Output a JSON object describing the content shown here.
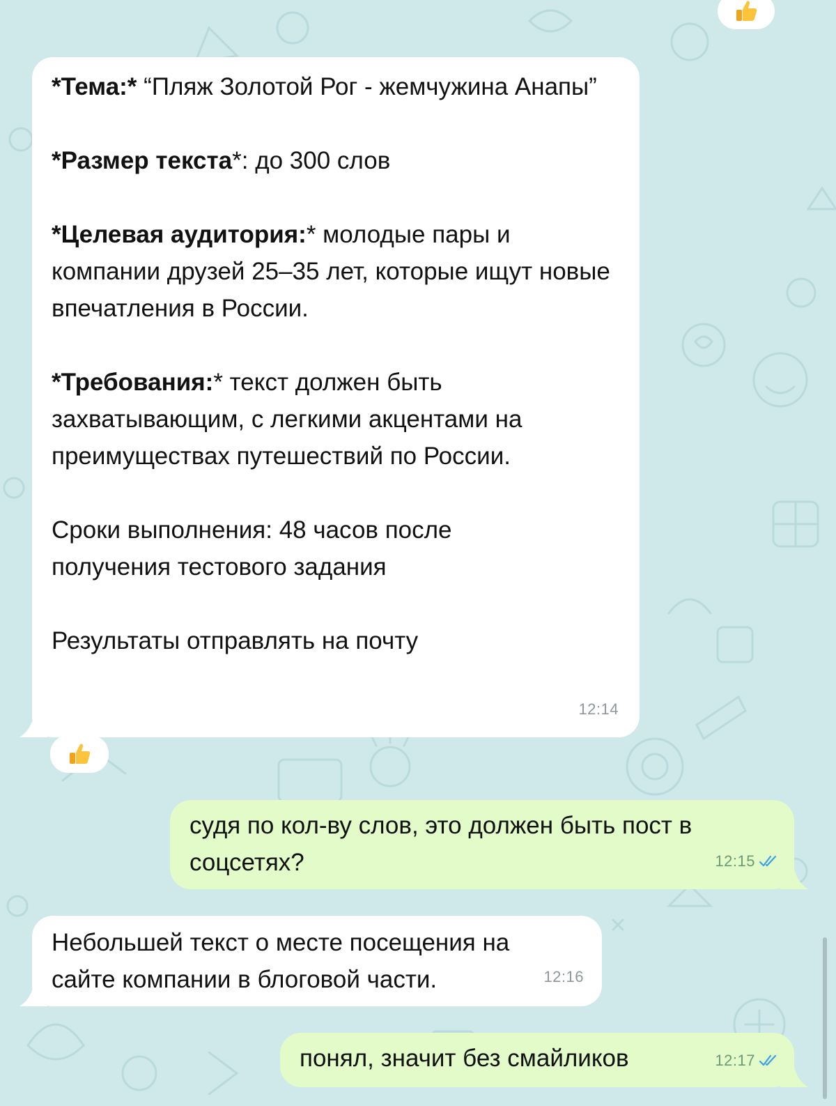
{
  "chat": {
    "top_reaction": {
      "emoji": "👍",
      "icon": "thumbs-up-icon"
    },
    "messages": [
      {
        "direction": "incoming",
        "sections": [
          {
            "bold": "*Тема:*",
            "text": " “Пляж Золотой Рог - жемчужина Анапы”"
          },
          {
            "bold": "*Размер текста",
            "text": "*: до 300 слов"
          },
          {
            "bold": "*Целевая аудитория:",
            "text": "* молодые пары и компании друзей 25–35 лет, которые ищут новые впечатления в России."
          },
          {
            "bold": "*Требования:",
            "text": "* текст должен быть захватывающим, с легкими акцентами на преимуществах путешествий по России."
          },
          {
            "bold": "",
            "text": "Сроки выполнения: 48 часов после получения тестового задания"
          },
          {
            "bold": "",
            "text": "Результаты отправлять на почту"
          }
        ],
        "time": "12:14",
        "reaction": {
          "emoji": "👍",
          "icon": "thumbs-up-icon"
        }
      },
      {
        "direction": "outgoing",
        "text": "судя по кол-ву слов, это должен быть пост в соцсетях?",
        "time": "12:15",
        "status": "read",
        "status_icon": "double-check-icon"
      },
      {
        "direction": "incoming",
        "text": "Небольшей текст о месте посещения на сайте компании в блоговой части.",
        "time": "12:16"
      },
      {
        "direction": "outgoing",
        "text": "понял, значит без смайликов",
        "time": "12:17",
        "status": "read",
        "status_icon": "double-check-icon"
      }
    ]
  },
  "colors": {
    "background": "#cfe8ea",
    "incoming_bubble": "#ffffff",
    "outgoing_bubble": "#e2fbc9",
    "read_check": "#3aa0e6"
  }
}
